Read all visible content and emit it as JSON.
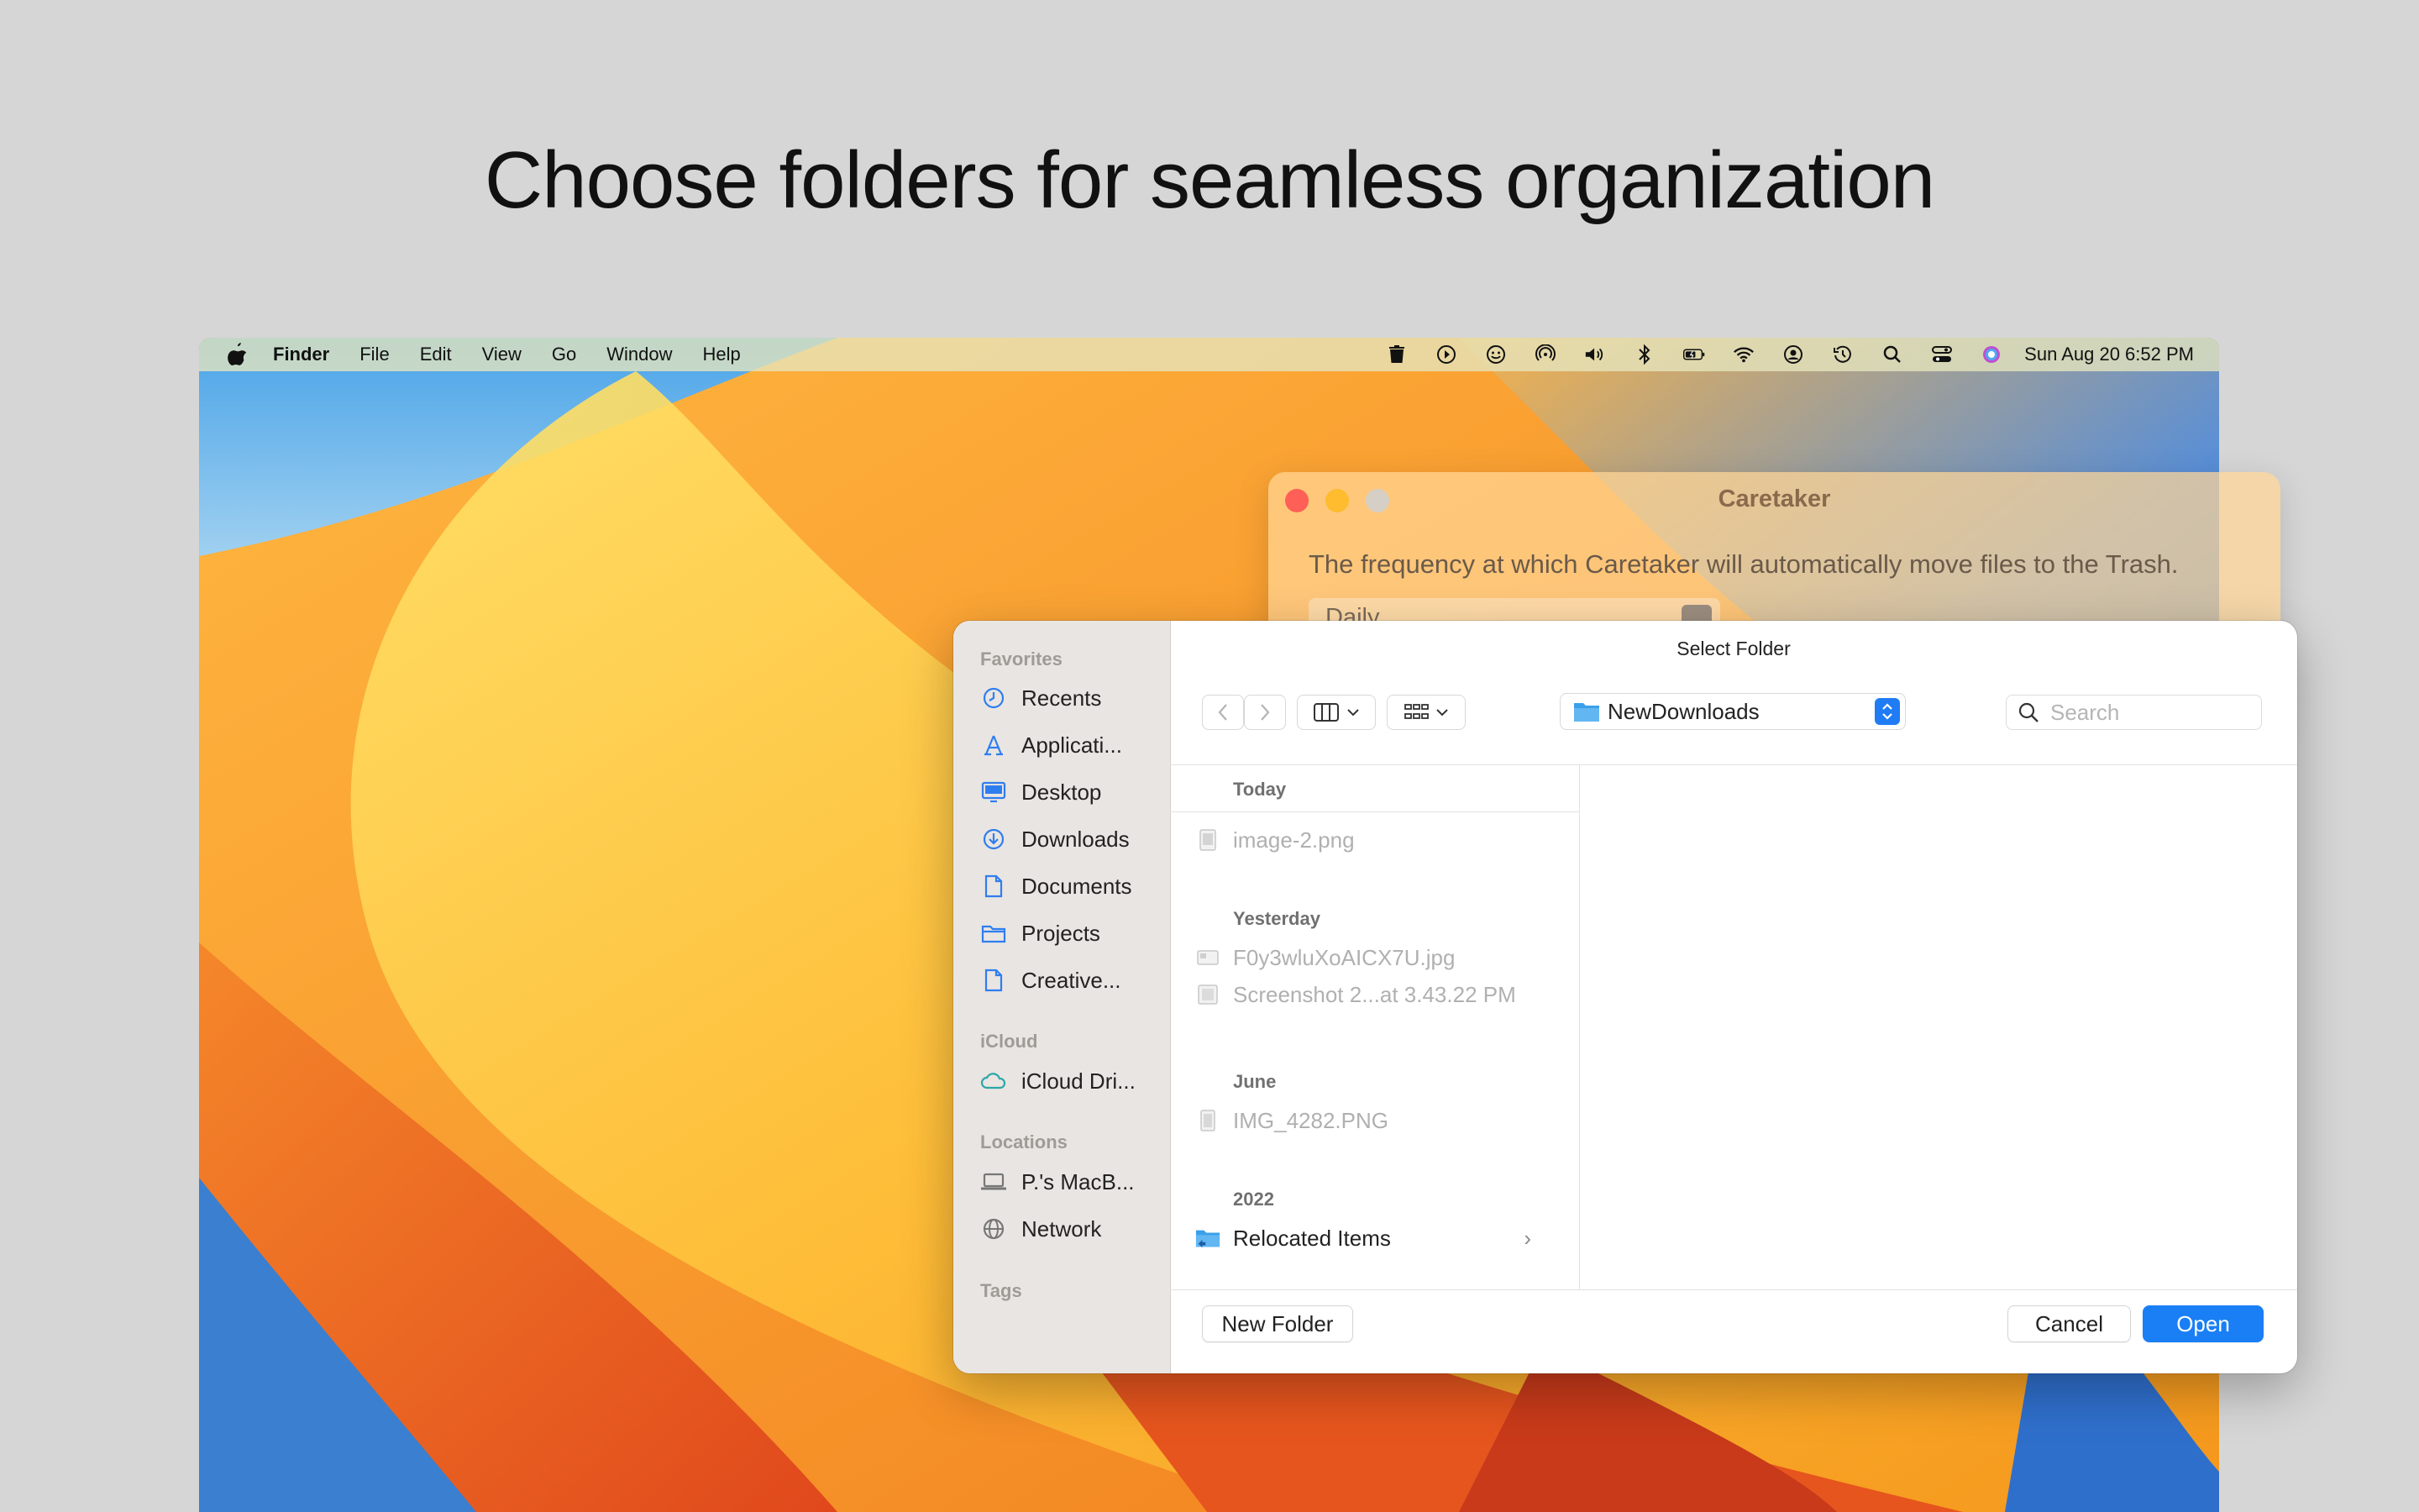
{
  "headline": "Choose folders for seamless organization",
  "menubar": {
    "app_name": "Finder",
    "menus": [
      "File",
      "Edit",
      "View",
      "Go",
      "Window",
      "Help"
    ],
    "clock": "Sun Aug 20  6:52 PM",
    "status_icons": [
      "trash-icon",
      "play-circle-icon",
      "smiley-icon",
      "airdrop-icon",
      "volume-icon",
      "bluetooth-icon",
      "battery-icon",
      "wifi-icon",
      "user-icon",
      "time-machine-icon",
      "spotlight-icon",
      "control-center-icon",
      "siri-icon"
    ]
  },
  "caretaker": {
    "title": "Caretaker",
    "description": "The frequency at which Caretaker will automatically move files to the Trash.",
    "frequency_value": "Daily"
  },
  "dialog": {
    "title": "Select Folder",
    "current_folder": "NewDownloads",
    "search_placeholder": "Search",
    "sidebar": {
      "favorites_label": "Favorites",
      "favorites": [
        {
          "label": "Recents",
          "icon": "clock-icon"
        },
        {
          "label": "Applicati...",
          "icon": "applications-icon"
        },
        {
          "label": "Desktop",
          "icon": "desktop-icon"
        },
        {
          "label": "Downloads",
          "icon": "downloads-icon"
        },
        {
          "label": "Documents",
          "icon": "document-icon"
        },
        {
          "label": "Projects",
          "icon": "folder-icon"
        },
        {
          "label": "Creative...",
          "icon": "document-icon"
        }
      ],
      "icloud_label": "iCloud",
      "icloud": [
        {
          "label": "iCloud Dri...",
          "icon": "cloud-icon"
        }
      ],
      "locations_label": "Locations",
      "locations": [
        {
          "label": "P.'s MacB...",
          "icon": "laptop-icon"
        },
        {
          "label": "Network",
          "icon": "globe-icon"
        }
      ],
      "tags_label": "Tags"
    },
    "groups": [
      {
        "heading": "Today",
        "files": [
          {
            "name": "image-2.png",
            "enabled": false
          }
        ]
      },
      {
        "heading": "Yesterday",
        "files": [
          {
            "name": "F0y3wluXoAICX7U.jpg",
            "enabled": false
          },
          {
            "name": "Screenshot 2...at 3.43.22 PM",
            "enabled": false
          }
        ]
      },
      {
        "heading": "June",
        "files": [
          {
            "name": "IMG_4282.PNG",
            "enabled": false
          }
        ]
      },
      {
        "heading": "2022",
        "files": [
          {
            "name": "Relocated Items",
            "enabled": true
          }
        ]
      }
    ],
    "buttons": {
      "new_folder": "New Folder",
      "cancel": "Cancel",
      "open": "Open"
    }
  },
  "colors": {
    "accent": "#1a7ff5",
    "window_close": "#fe5f57",
    "window_minimize": "#febc2e",
    "window_zoom": "#d5cfc6"
  }
}
